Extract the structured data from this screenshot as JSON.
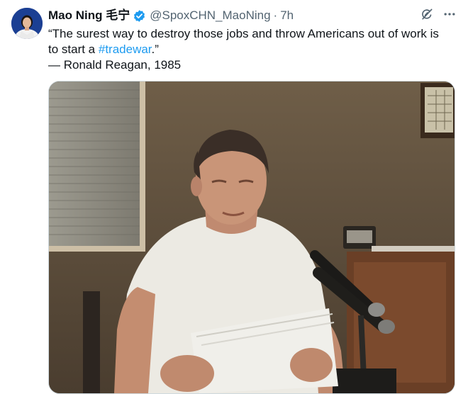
{
  "tweet": {
    "author_name": "Mao Ning 毛宁",
    "handle": "@SpoxCHN_MaoNing",
    "separator": "·",
    "time": "7h",
    "text_line1": "“The surest way to destroy those jobs and throw Americans out of work is",
    "text_line2_before": "to start a ",
    "hashtag": "#tradewar",
    "text_line2_after": ".”",
    "text_line3": "— Ronald Reagan, 1985"
  },
  "icons": {
    "verified": "verified-badge-icon",
    "grok": "grok-icon",
    "more": "more-icon"
  },
  "colors": {
    "verified": "#1d9bf0",
    "hashtag": "#1d9bf0",
    "secondary_text": "#536471"
  }
}
